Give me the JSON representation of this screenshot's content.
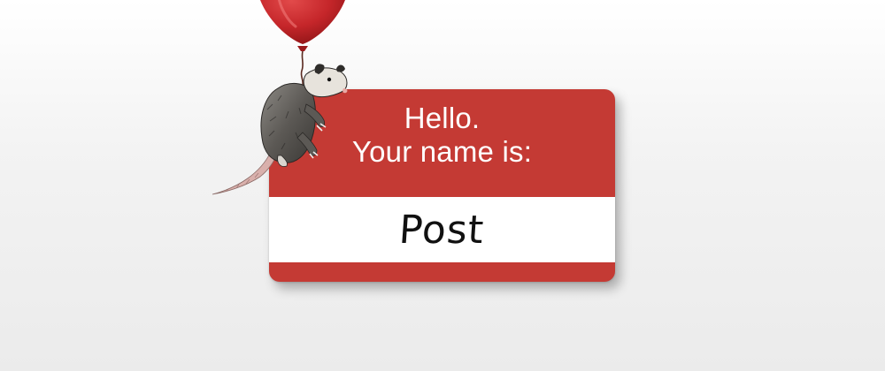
{
  "name_tag": {
    "greeting": "Hello.",
    "prompt": "Your name is:",
    "name": "Post"
  },
  "illustration": {
    "balloon_icon": "balloon-icon",
    "animal_icon": "opossum-icon"
  },
  "colors": {
    "tag_red": "#c43a34",
    "balloon_red": "#c5262a",
    "background": "#efefef"
  }
}
